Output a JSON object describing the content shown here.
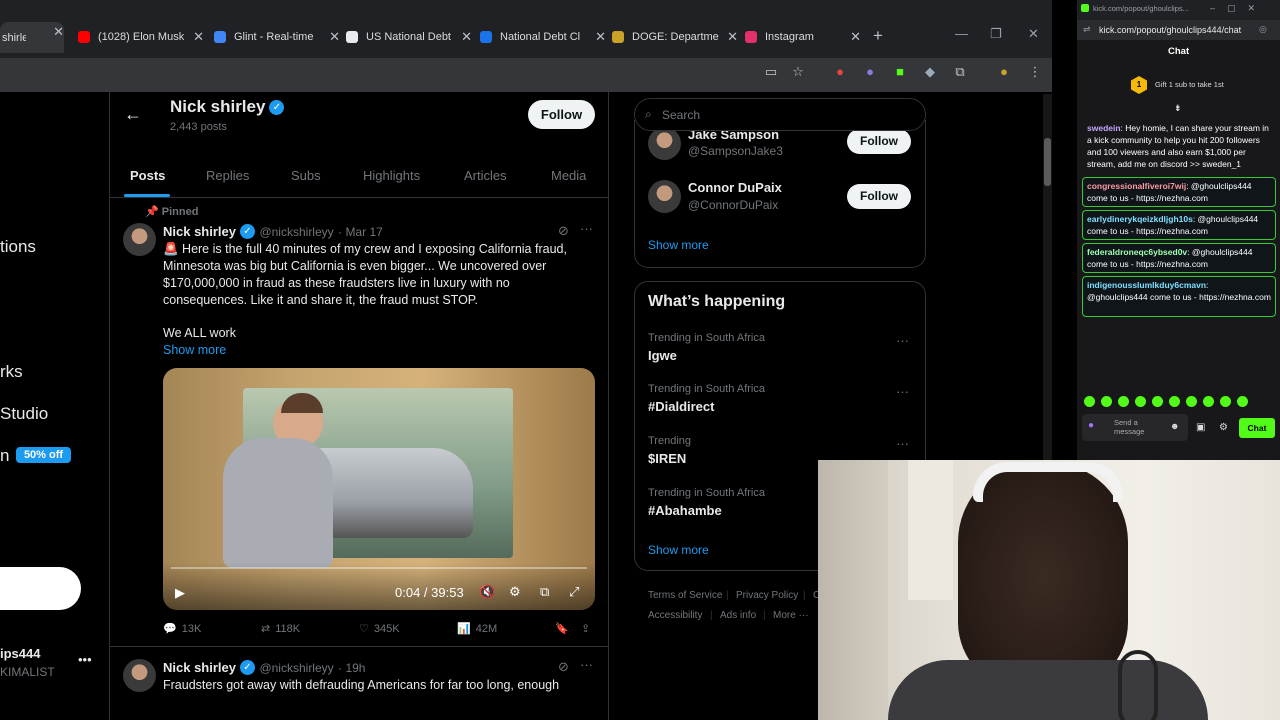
{
  "browser": {
    "tabs": [
      {
        "title": "shirley (",
        "color": "#9aa0a6"
      },
      {
        "title": "(1028) Elon Musk",
        "color": "#ff0000"
      },
      {
        "title": "Glint - Real-time",
        "color": "#4285f4"
      },
      {
        "title": "US National Debt",
        "color": "#e8eaed"
      },
      {
        "title": "National Debt Cl",
        "color": "#1a73e8"
      },
      {
        "title": "DOGE: Departme",
        "color": "#c9a227"
      },
      {
        "title": "Instagram",
        "color": "#e1306c"
      }
    ]
  },
  "leftnav": {
    "items": [
      "tions",
      "rks",
      "Studio",
      "n"
    ],
    "badge": "50% off",
    "account_handle": "ips444",
    "account_sub": "KIMALIST"
  },
  "profile": {
    "name": "Nick shirley",
    "posts": "2,443 posts",
    "follow_label": "Follow",
    "tabs": [
      "Posts",
      "Replies",
      "Subs",
      "Highlights",
      "Articles",
      "Media"
    ]
  },
  "pinned_tweet": {
    "pinned_label": "Pinned",
    "name": "Nick shirley",
    "handle": "@nickshirleyy",
    "date": "· Mar 17",
    "text": "🚨 Here is the full 40 minutes of my crew and I exposing California fraud, Minnesota was big but California is even bigger... We uncovered over $170,000,000 in fraud as these fraudsters live in luxury with no consequences. Like it and share it, the fraud must STOP.",
    "text2": "We ALL work",
    "show_more": "Show more",
    "video_time": "0:04 / 39:53",
    "replies": "13K",
    "reposts": "118K",
    "likes": "345K",
    "views": "42M"
  },
  "second_tweet": {
    "name": "Nick shirley",
    "handle": "@nickshirleyy",
    "date": "· 19h",
    "text": "Fraudsters got away with defrauding Americans for far too long, enough"
  },
  "sidebar": {
    "search_placeholder": "Search",
    "who_to_follow": [
      {
        "name": "Jake Sampson",
        "handle": "@SampsonJake3",
        "button": "Follow"
      },
      {
        "name": "Connor DuPaix",
        "handle": "@ConnorDuPaix",
        "button": "Follow"
      }
    ],
    "show_more": "Show more",
    "whats_happening_title": "What’s happening",
    "trends": [
      {
        "meta": "Trending in South Africa",
        "name": "Igwe"
      },
      {
        "meta": "Trending in South Africa",
        "name": "#Dialdirect"
      },
      {
        "meta": "Trending",
        "name": "$IREN"
      },
      {
        "meta": "Trending in South Africa",
        "name": "#Abahambe"
      }
    ],
    "show_more2": "Show more",
    "footer": [
      "Terms of Service",
      "Privacy Policy",
      "C",
      "Accessibility",
      "Ads info",
      "More ···"
    ]
  },
  "kick": {
    "url_top": "kick.com/popout/ghoulclips...",
    "url": "kick.com/popout/ghoulclips444/chat",
    "chat_title": "Chat",
    "gift_text": "Gift 1 sub to take 1st",
    "gift_count": "1",
    "messages": [
      {
        "user": "swedein",
        "text": ": Hey homie, I can share your stream in a kick community to help you hit 200 followers and 100 viewers and also earn $1,000 per stream, add me on discord >> sweden_1",
        "color": "#c6a5ff"
      },
      {
        "user": "congressionalfiveroi7wij",
        "text": ": @ghoulclips444 come to us - https://nezhna.com",
        "color": "#ff9aa2"
      },
      {
        "user": "earlydinerykqeizkdljgh10s",
        "text": ": @ghoulclips444 come to us - https://nezhna.com",
        "color": "#7ee0ff"
      },
      {
        "user": "federaldroneqc6ybsed0v",
        "text": ": @ghoulclips444 come to us - https://nezhna.com",
        "color": "#a0ffb0"
      },
      {
        "user": "indigenousslumlkduy6cmavn",
        "text": ": @ghoulclips444 come to us - https://nezhna.com",
        "color": "#7ee0ff"
      }
    ],
    "send_placeholder": "Send a message",
    "chat_button": "Chat",
    "accent": "#53fc18"
  }
}
